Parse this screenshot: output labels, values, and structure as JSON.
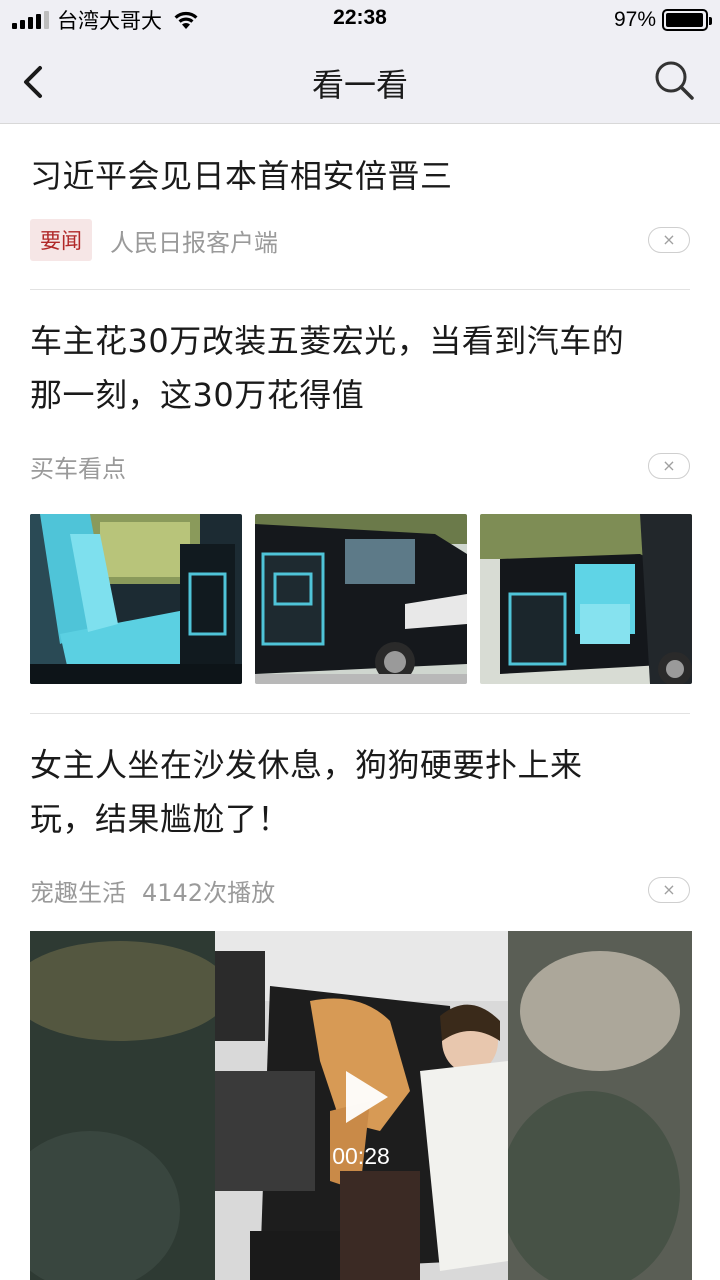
{
  "status_bar": {
    "carrier": "台湾大哥大",
    "time": "22:38",
    "battery": "97%",
    "battery_level": 0.97
  },
  "nav": {
    "title": "看一看",
    "back_icon": "chevron-left-icon",
    "search_icon": "search-icon"
  },
  "feed": {
    "items": [
      {
        "title": "习近平会见日本首相安倍晋三",
        "tag": "要闻",
        "source": "人民日报客户端",
        "close": "×"
      },
      {
        "title_lines": [
          "车主花30万改装五菱宏光，当看到汽车的",
          "那一刻，这30万花得值"
        ],
        "source": "买车看点",
        "close": "×",
        "images": [
          "van-interior-blue-seats",
          "black-van-side",
          "van-open-doors"
        ]
      },
      {
        "title_lines": [
          "女主人坐在沙发休息，狗狗硬要扑上来",
          "玩，结果尴尬了！"
        ],
        "source": "宠趣生活",
        "views": "4142次播放",
        "close": "×",
        "video_duration": "00:28"
      }
    ]
  },
  "colors": {
    "bar_bg": "#efeff4",
    "tag_bg": "#f6e6e6",
    "tag_text": "#b02828",
    "meta_text": "#9a9a9a"
  }
}
